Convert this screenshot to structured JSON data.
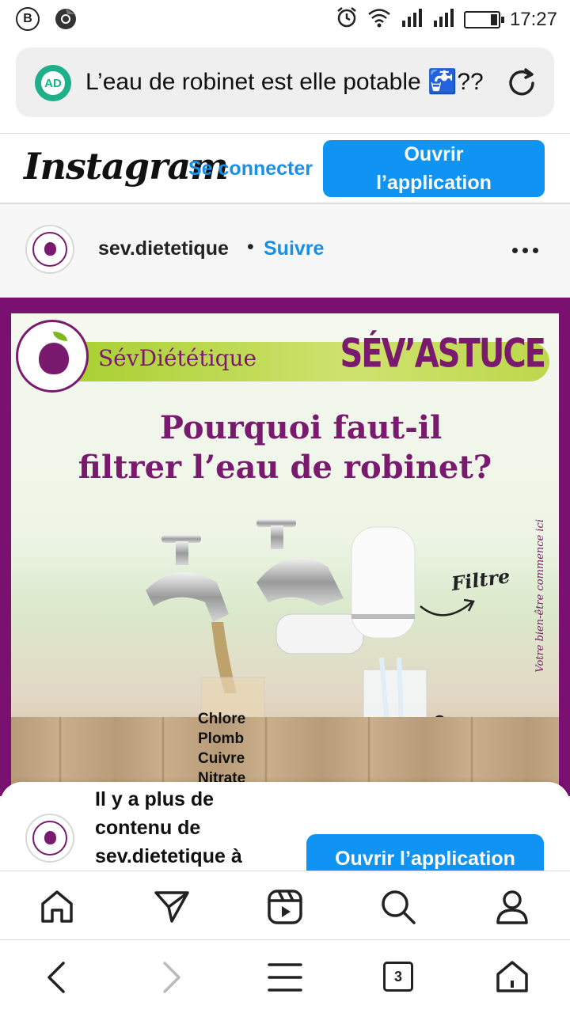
{
  "status_bar": {
    "left_icons": [
      "b-notification-icon",
      "chrome-icon"
    ],
    "left_letter": "B",
    "right_icons": [
      "alarm-icon",
      "wifi-icon",
      "signal-icon-1",
      "signal-icon-2",
      "battery-icon"
    ],
    "time": "17:27"
  },
  "url_bar": {
    "badge_label": "AD",
    "title": "L’eau de robinet est elle potable 🚰??",
    "reload_icon": "reload-icon"
  },
  "ig_header": {
    "logo": "Instagram",
    "login_label": "Se connecter",
    "open_app_label": "Ouvrir l’application",
    "accent_color": "#0f94f3"
  },
  "post": {
    "username": "sev.dietetique",
    "separator": "•",
    "follow_label": "Suivre",
    "more_icon": "more-horizontal-icon",
    "image": {
      "brand_name": "SévDiététique",
      "badge": "SÉV’ASTUCE",
      "headline_line1": "Pourquoi faut-il",
      "headline_line2": "filtrer l’eau de robinet?",
      "side_caption": "Votre bien-être commence ici",
      "filter_label": "Filtre",
      "contaminants": [
        "Chlore",
        "Plomb",
        "Cuivre",
        "Nitrate"
      ],
      "brand_color": "#7a1a6e",
      "band_color": "#a7cf2f"
    }
  },
  "bottom_sheet": {
    "text": "Il y a plus de contenu de sev.dietetique à",
    "button_label": "Ouvrir l’application"
  },
  "ig_nav": {
    "items": [
      "home-icon",
      "direct-message-icon",
      "reels-icon",
      "search-icon",
      "profile-icon"
    ]
  },
  "browser_bar": {
    "back_icon": "back-arrow-icon",
    "forward_icon": "forward-arrow-icon",
    "menu_icon": "menu-icon",
    "tab_count": "3",
    "home_icon": "home-icon"
  }
}
